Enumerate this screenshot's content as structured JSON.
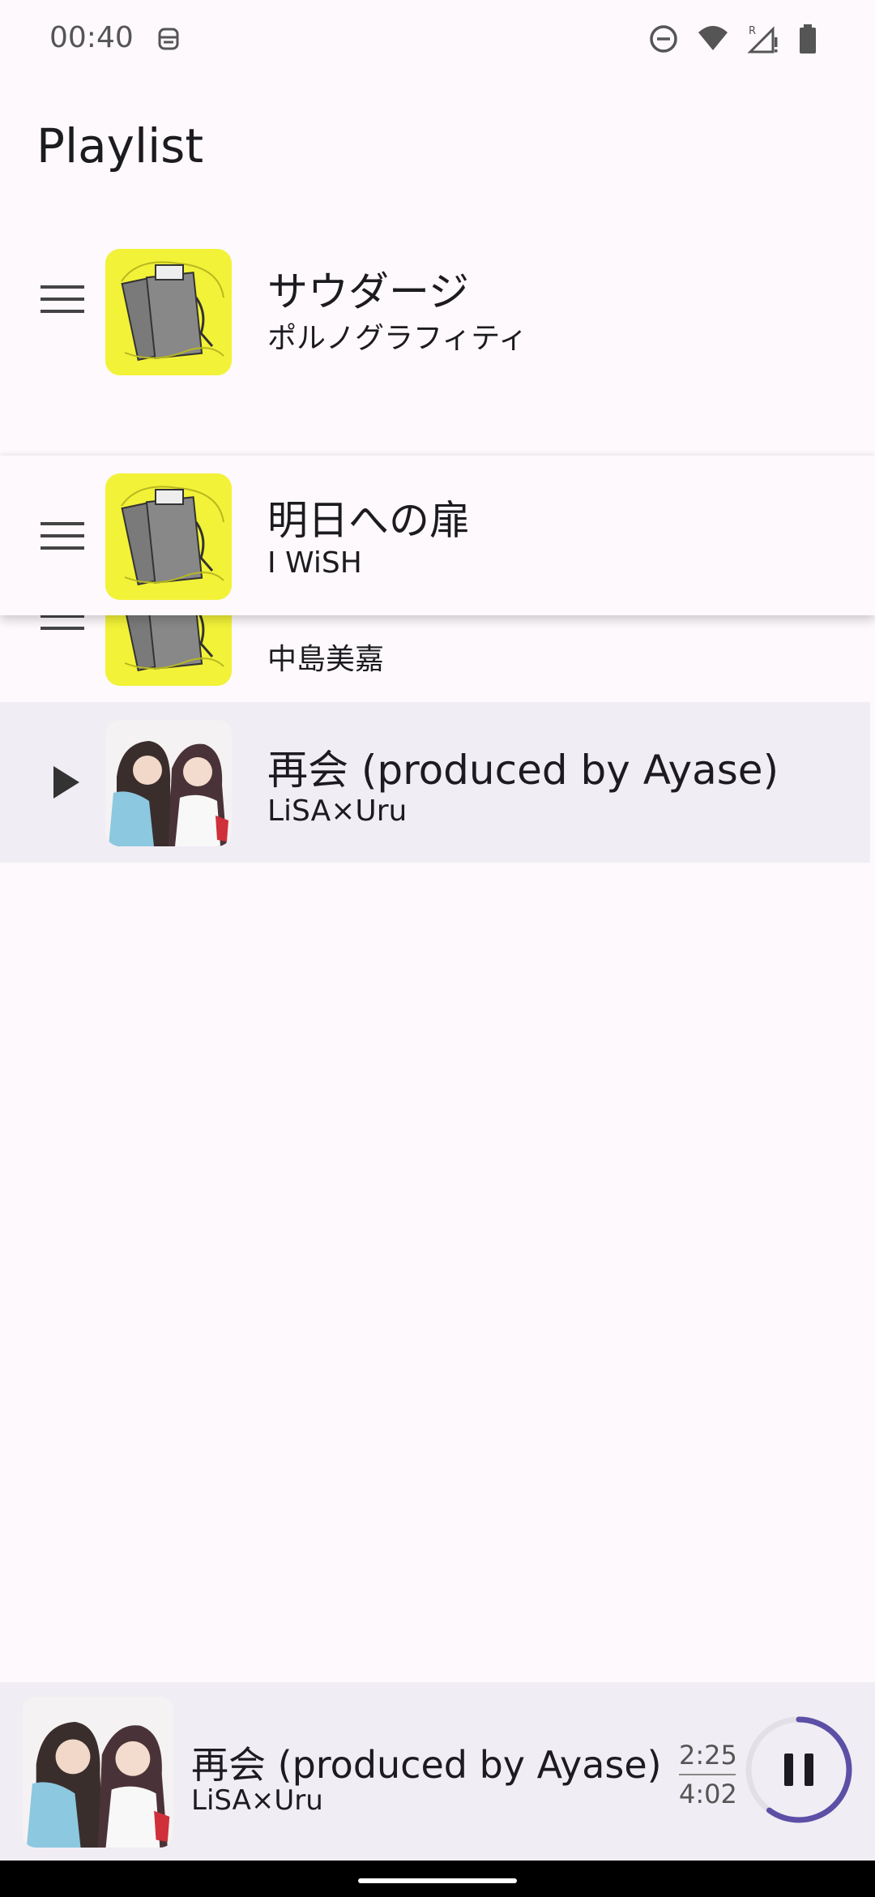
{
  "status_bar": {
    "time": "00:40",
    "icons": [
      "face-icon",
      "dnd-icon",
      "wifi-icon",
      "signal-icon",
      "battery-icon"
    ],
    "signal_badge": "R"
  },
  "header": {
    "title": "Playlist"
  },
  "playlist": [
    {
      "title": "サウダージ",
      "artist": "ポルノグラフィティ",
      "state": "idle"
    },
    {
      "title": "明日への扉",
      "artist": "I WiSH",
      "state": "dragging"
    },
    {
      "title": "",
      "artist": "中島美嘉",
      "state": "partially-covered"
    },
    {
      "title": "再会 (produced by Ayase)",
      "artist": "LiSA×Uru",
      "state": "playing"
    }
  ],
  "mini_player": {
    "title": "再会 (produced by Ayase)",
    "artist": "LiSA×Uru",
    "elapsed": "2:25",
    "duration": "4:02",
    "progress": 0.6,
    "control_icon": "pause-icon"
  },
  "colors": {
    "background": "#fdf9fc",
    "highlight": "#f1edf4",
    "accent": "#5b4fa6",
    "album_yellow": "#f2f238"
  }
}
